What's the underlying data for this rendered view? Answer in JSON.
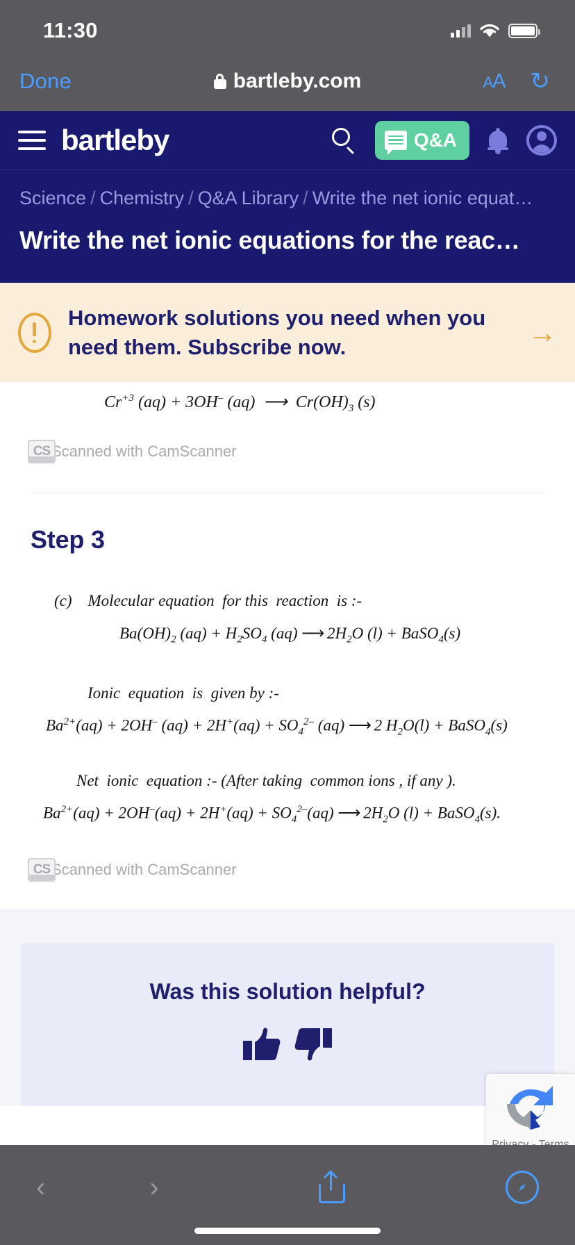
{
  "status_bar": {
    "time": "11:30",
    "cellular_icon": "cellular-bars-icon",
    "wifi_icon": "wifi-icon",
    "battery_icon": "battery-full-icon"
  },
  "browser_bar": {
    "done_label": "Done",
    "lock_icon": "lock-icon",
    "url": "bartleby.com",
    "text_size_label": "AA",
    "reload_glyph": "↻"
  },
  "site_nav": {
    "menu_icon": "hamburger-menu-icon",
    "logo_text": "bartleby",
    "search_icon": "search-icon",
    "qa_button_label": "Q&A",
    "qa_icon": "message-lines-icon",
    "bell_icon": "notification-bell-icon",
    "account_icon": "user-avatar-icon",
    "brand_navy": "#191970",
    "qa_green": "#5fd0a0"
  },
  "breadcrumb": {
    "items": [
      "Science",
      "Chemistry",
      "Q&A Library",
      "Write the net ionic equat…"
    ],
    "separator": "/"
  },
  "page_title": "Write the net ionic equations for the reac…",
  "promo_banner": {
    "icon": "alert-exclamation-icon",
    "text": "Homework solutions you need when you need them. Subscribe now.",
    "arrow_glyph": "→",
    "bg_color": "#faeedb",
    "accent_color": "#e2a83c"
  },
  "solution": {
    "top_equation": "Cr+3 (aq) + 3OH− (aq) ⟶ Cr(OH)3 (s)",
    "watermark_top": {
      "logo": "CS",
      "text": "Scanned with CamScanner"
    },
    "step_heading": "Step 3",
    "handwritten_lines": [
      "(c)   Molecular equation for this reaction is :-",
      "Ba(OH)2 (aq) + H2SO4 (aq) ⟶ 2H2O (l) + BaSO4(s)",
      "Ionic equation is given by :-",
      "Ba2+(aq) + 2OH−(aq) + 2H+(aq) + SO4 2−(aq) ⟶ 2 H2O(l) + BaSO4(s)",
      "Net ionic equation :- (After taking common ions, if any).",
      "Ba2+(aq) + 2OH−(aq) + 2H+(aq) + SO4 2−(aq) ⟶ 2H2O (l) + BaSO4(s)."
    ],
    "watermark_bottom": {
      "logo": "CS",
      "text": "Scanned with CamScanner"
    }
  },
  "feedback": {
    "question": "Was this solution helpful?",
    "thumbs_up_icon": "thumbs-up-icon",
    "thumbs_down_icon": "thumbs-down-icon",
    "bg_color": "#e9ebf8"
  },
  "recaptcha": {
    "logo_icon": "recaptcha-logo-icon",
    "text": "Privacy - Terms"
  },
  "bottom_toolbar": {
    "back_glyph": "‹",
    "forward_glyph": "›",
    "share_icon": "share-icon",
    "safari_icon": "safari-compass-icon"
  }
}
